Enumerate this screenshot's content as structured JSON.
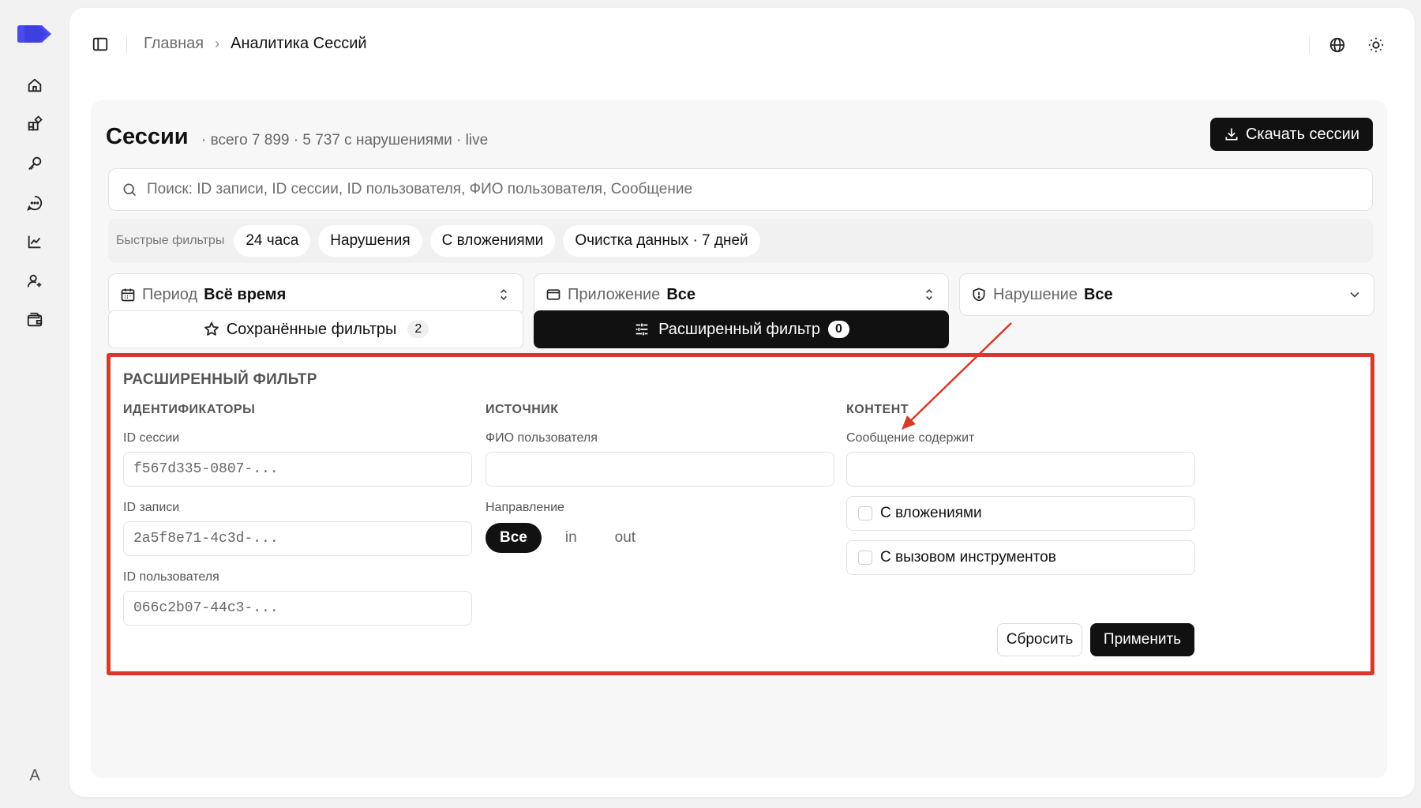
{
  "breadcrumb": {
    "home": "Главная",
    "separator": "›",
    "current": "Аналитика Сессий"
  },
  "header": {
    "title": "Сессии",
    "subtitle": "· всего 7 899 · 5 737 с нарушениями · live",
    "download_label": "Скачать сессии"
  },
  "search": {
    "placeholder": "Поиск: ID записи, ID сессии, ID пользователя, ФИО пользователя, Сообщение"
  },
  "quick_filters": {
    "label": "Быстрые фильтры",
    "chips": [
      "24 часа",
      "Нарушения",
      "С вложениями",
      "Очистка данных · 7 дней"
    ]
  },
  "selects": {
    "period": {
      "label": "Период",
      "value": "Всё время"
    },
    "app": {
      "label": "Приложение",
      "value": "Все"
    },
    "violation": {
      "label": "Нарушение",
      "value": "Все"
    }
  },
  "saved_filters": {
    "label": "Сохранённые фильтры",
    "count": "2"
  },
  "advanced_filter": {
    "label": "Расширенный фильтр",
    "count": "0"
  },
  "adv": {
    "title": "РАСШИРЕННЫЙ ФИЛЬТР",
    "identifiers": {
      "heading": "ИДЕНТИФИКАТОРЫ",
      "session_label": "ID сессии",
      "session_placeholder": "f567d335-0807-...",
      "record_label": "ID записи",
      "record_placeholder": "2a5f8e71-4c3d-...",
      "user_label": "ID пользователя",
      "user_placeholder": "066c2b07-44c3-..."
    },
    "source": {
      "heading": "ИСТОЧНИК",
      "name_label": "ФИО пользователя",
      "direction_label": "Направление",
      "directions": [
        "Все",
        "in",
        "out"
      ],
      "direction_selected": "Все"
    },
    "content": {
      "heading": "КОНТЕНТ",
      "message_label": "Сообщение содержит",
      "checkbox_attachments": "С вложениями",
      "checkbox_tools": "С вызовом инструментов"
    },
    "reset_label": "Сбросить",
    "apply_label": "Применить"
  },
  "user": {
    "avatar_letter": "A"
  },
  "colors": {
    "accent": "#111111",
    "highlight": "#d63a2a",
    "logo": "#4a4cf0"
  }
}
